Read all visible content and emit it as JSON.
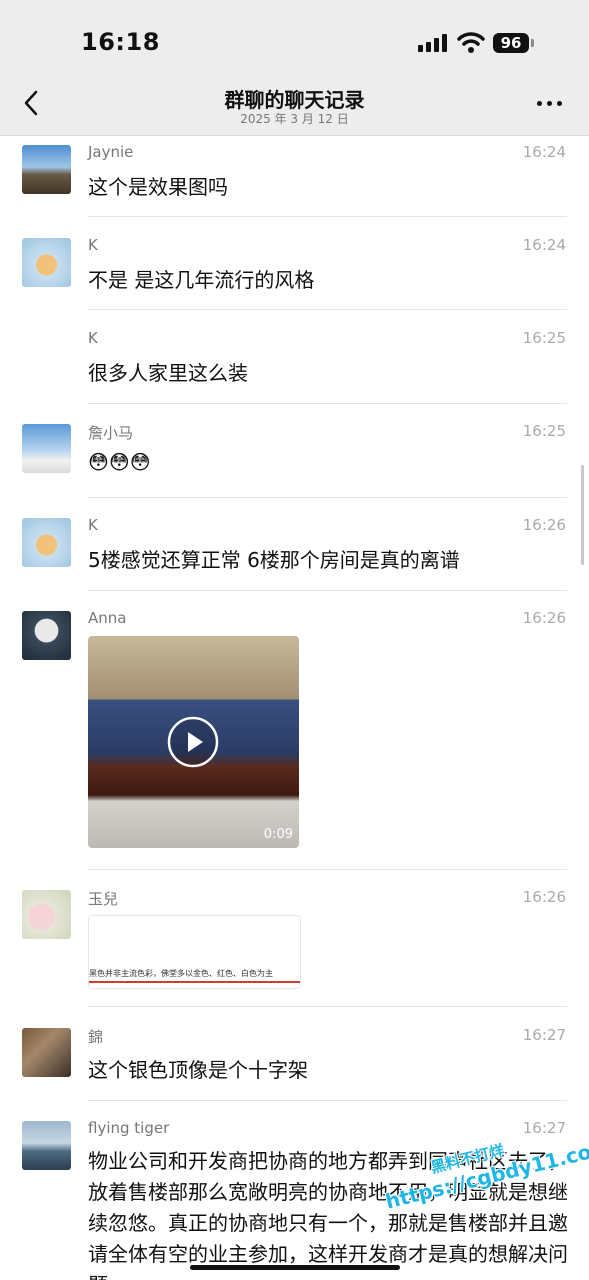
{
  "status_bar": {
    "time": "16:18",
    "battery": "96"
  },
  "nav": {
    "title": "群聊的聊天记录",
    "date": "2025 年 3 月 12 日"
  },
  "messages": [
    {
      "name": "Jaynie",
      "time": "16:24",
      "text": "这个是效果图吗"
    },
    {
      "name": "K",
      "time": "16:24",
      "text": "不是 是这几年流行的风格"
    },
    {
      "name": "K",
      "time": "16:25",
      "text": "很多人家里这么装"
    },
    {
      "name": "詹小马",
      "time": "16:25",
      "text": "😳😳😳"
    },
    {
      "name": "K",
      "time": "16:26",
      "text": "5楼感觉还算正常 6楼那个房间是真的离谱"
    },
    {
      "name": "Anna",
      "time": "16:26",
      "video_duration": "0:09"
    },
    {
      "name": "玉兒",
      "time": "16:26",
      "card_text": "黑色并非主流色彩，佛堂多以金色、红色、白色为主"
    },
    {
      "name": "錦",
      "time": "16:27",
      "text": "这个银色顶像是个十字架"
    },
    {
      "name": "flying tiger",
      "time": "16:27",
      "text": "物业公司和开发商把协商的地方都弄到同声社区去了，放着售楼部那么宽敞明亮的协商地不用，明显就是想继续忽悠。真正的协商地只有一个，那就是售楼部并且邀请全体有空的业主参加，这样开发商才是真的想解决问题"
    }
  ],
  "watermark": {
    "line1": "黑料不打烊",
    "line2": "https://cgbdy11.com"
  }
}
